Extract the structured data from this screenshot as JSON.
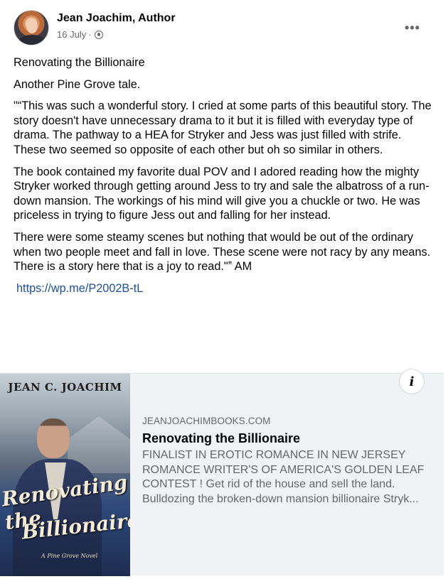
{
  "post": {
    "author_name": "Jean Joachim, Author",
    "date": "16 July",
    "date_separator": "·",
    "privacy_icon": "globe-icon",
    "more_icon": "more-options-icon",
    "more_label": "•••"
  },
  "content": {
    "paragraphs": [
      "Renovating the Billionaire",
      "Another Pine Grove tale.",
      "\"“This was such a wonderful story. I cried at some parts of this beautiful story. The story doesn't have unnecessary drama to it but it is filled with everyday type of drama. The pathway to a HEA for Stryker and Jess was just filled with strife. These two seemed so opposite of each other but oh so similar in others.",
      "The book contained my favorite dual POV and I adored reading how the mighty Stryker worked through getting around Jess to try and sale the albatross of a run-down mansion. The workings of his mind will give you a chuckle or two. He was priceless in trying to figure Jess out and falling for her instead.",
      "There were some steamy scenes but nothing that would be out of the ordinary when two people meet and fall in love. These scene were not racy by any means. There is a story here that is a joy to read.\"ˮ AM"
    ],
    "link": "https://wp.me/P2002B-tL"
  },
  "link_preview": {
    "cover": {
      "author_band": "JEAN C. JOACHIM",
      "title_line1": "Renovating the",
      "title_line2": "Billionaire",
      "series": "A Pine Grove Novel"
    },
    "info_icon": "info-icon",
    "info_label": "i",
    "domain": "JEANJOACHIMBOOKS.COM",
    "title": "Renovating the Billionaire",
    "description": "FINALIST IN EROTIC ROMANCE IN NEW JERSEY ROMANCE WRITER'S OF AMERICA'S GOLDEN LEAF CONTEST ! Get rid of the house and sell the land. Bulldozing the broken-down mansion billionaire Stryk..."
  }
}
